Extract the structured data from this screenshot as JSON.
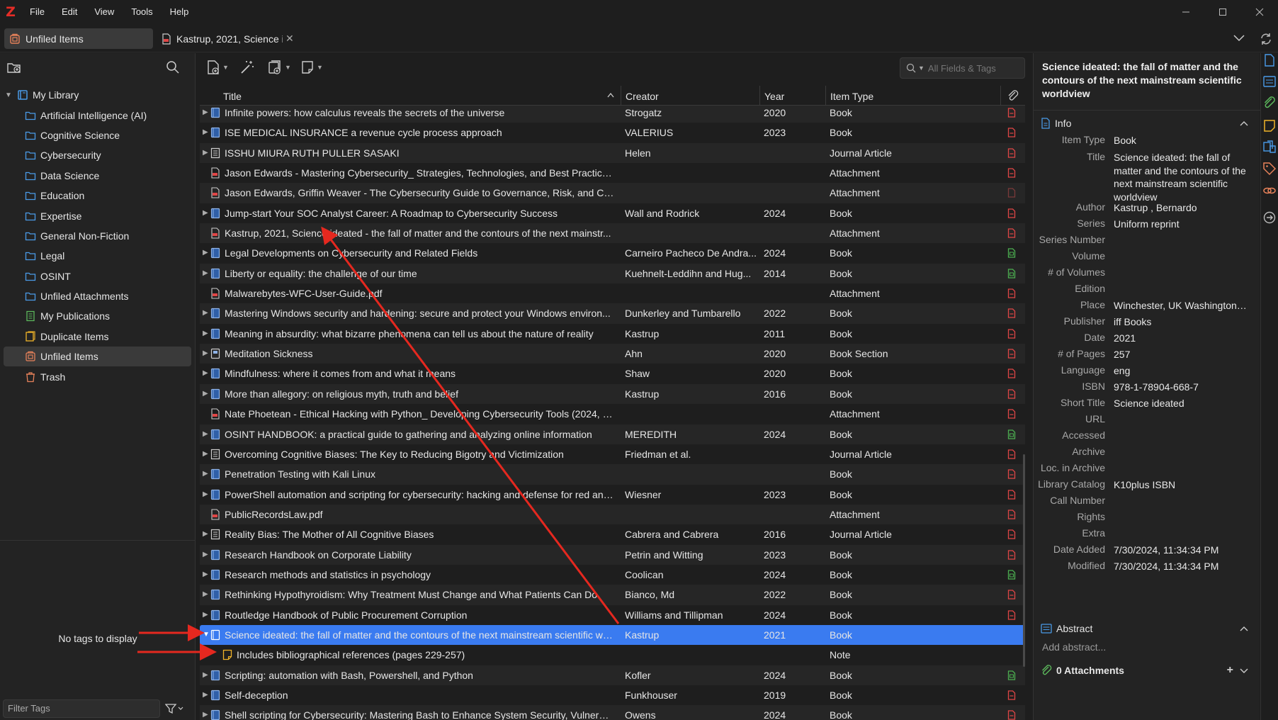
{
  "menubar": {
    "logo": "Z",
    "items": [
      "File",
      "Edit",
      "View",
      "Tools",
      "Help"
    ]
  },
  "tabs": {
    "library_tab": "Unfiled Items",
    "reader_tab": "Kastrup, 2021, Science ide",
    "close_glyph": "✕"
  },
  "collections": {
    "root": "My Library",
    "items": [
      {
        "label": "Artificial Intelligence (AI)",
        "icon": "folder-icon"
      },
      {
        "label": "Cognitive Science",
        "icon": "folder-icon"
      },
      {
        "label": "Cybersecurity",
        "icon": "folder-icon"
      },
      {
        "label": "Data Science",
        "icon": "folder-icon"
      },
      {
        "label": "Education",
        "icon": "folder-icon"
      },
      {
        "label": "Expertise",
        "icon": "folder-icon"
      },
      {
        "label": "General Non-Fiction",
        "icon": "folder-icon"
      },
      {
        "label": "Legal",
        "icon": "folder-icon"
      },
      {
        "label": "OSINT",
        "icon": "folder-icon"
      },
      {
        "label": "Unfiled Attachments",
        "icon": "folder-icon"
      },
      {
        "label": "My Publications",
        "icon": "publications-icon"
      },
      {
        "label": "Duplicate Items",
        "icon": "duplicate-icon"
      },
      {
        "label": "Unfiled Items",
        "icon": "unfiled-icon"
      },
      {
        "label": "Trash",
        "icon": "trash-icon"
      }
    ]
  },
  "tags": {
    "empty_message": "No tags to display",
    "filter_placeholder": "Filter Tags"
  },
  "search": {
    "placeholder": "All Fields & Tags"
  },
  "table": {
    "headers": {
      "title": "Title",
      "creator": "Creator",
      "year": "Year",
      "type": "Item Type"
    },
    "rows": [
      {
        "title": "Infinite powers: how calculus reveals the secrets of the universe",
        "creator": "Strogatz",
        "year": "2020",
        "type": "Book",
        "icon": "book",
        "att": "pdf",
        "expand": true
      },
      {
        "title": "ISE MEDICAL INSURANCE a revenue cycle process approach",
        "creator": "VALERIUS",
        "year": "2023",
        "type": "Book",
        "icon": "book",
        "att": "pdf",
        "expand": true
      },
      {
        "title": "ISSHU MIURA RUTH PULLER SASAKI",
        "creator": "Helen",
        "year": "",
        "type": "Journal Article",
        "icon": "article",
        "att": "pdf",
        "expand": true
      },
      {
        "title": "Jason Edwards - Mastering Cybersecurity_ Strategies, Technologies, and Best Practices-...",
        "creator": "",
        "year": "",
        "type": "Attachment",
        "icon": "pdf",
        "att": "pdf",
        "expand": false
      },
      {
        "title": "Jason Edwards, Griffin Weaver - The Cybersecurity Guide to Governance, Risk, and Com...",
        "creator": "",
        "year": "",
        "type": "Attachment",
        "icon": "pdf",
        "att": "pdf-dim",
        "expand": false
      },
      {
        "title": "Jump-start Your SOC Analyst Career: A Roadmap to Cybersecurity Success",
        "creator": "Wall and Rodrick",
        "year": "2024",
        "type": "Book",
        "icon": "book",
        "att": "pdf",
        "expand": true
      },
      {
        "title": "Kastrup, 2021, Science ideated - the fall of matter and the contours of the next mainstr...",
        "creator": "",
        "year": "",
        "type": "Attachment",
        "icon": "pdf",
        "att": "pdf",
        "expand": false
      },
      {
        "title": "Legal Developments on Cybersecurity and Related Fields",
        "creator": "Carneiro Pacheco De Andra...",
        "year": "2024",
        "type": "Book",
        "icon": "book",
        "att": "epub",
        "expand": true
      },
      {
        "title": "Liberty or equality: the challenge of our time",
        "creator": "Kuehnelt-Leddihn and Hug...",
        "year": "2014",
        "type": "Book",
        "icon": "book",
        "att": "epub",
        "expand": true
      },
      {
        "title": "Malwarebytes-WFC-User-Guide.pdf",
        "creator": "",
        "year": "",
        "type": "Attachment",
        "icon": "pdf",
        "att": "pdf",
        "expand": false
      },
      {
        "title": "Mastering Windows security and hardening: secure and protect your Windows environ...",
        "creator": "Dunkerley and Tumbarello",
        "year": "2022",
        "type": "Book",
        "icon": "book",
        "att": "pdf",
        "expand": true
      },
      {
        "title": "Meaning in absurdity: what bizarre phenomena can tell us about the nature of reality",
        "creator": "Kastrup",
        "year": "2011",
        "type": "Book",
        "icon": "book",
        "att": "pdf",
        "expand": true
      },
      {
        "title": "Meditation Sickness",
        "creator": "Ahn",
        "year": "2020",
        "type": "Book Section",
        "icon": "section",
        "att": "pdf",
        "expand": true
      },
      {
        "title": "Mindfulness: where it comes from and what it means",
        "creator": "Shaw",
        "year": "2020",
        "type": "Book",
        "icon": "book",
        "att": "pdf",
        "expand": true
      },
      {
        "title": "More than allegory: on religious myth, truth and belief",
        "creator": "Kastrup",
        "year": "2016",
        "type": "Book",
        "icon": "book",
        "att": "pdf",
        "expand": true
      },
      {
        "title": "Nate Phoetean - Ethical Hacking with Python_ Developing Cybersecurity Tools (2024, In...",
        "creator": "",
        "year": "",
        "type": "Attachment",
        "icon": "pdf",
        "att": "pdf",
        "expand": false
      },
      {
        "title": "OSINT HANDBOOK: a practical guide to gathering and analyzing online information",
        "creator": "MEREDITH",
        "year": "2024",
        "type": "Book",
        "icon": "book",
        "att": "epub",
        "expand": true
      },
      {
        "title": "Overcoming Cognitive Biases: The Key to Reducing Bigotry and Victimization",
        "creator": "Friedman et al.",
        "year": "",
        "type": "Journal Article",
        "icon": "article",
        "att": "pdf",
        "expand": true
      },
      {
        "title": "Penetration Testing with Kali Linux",
        "creator": "",
        "year": "",
        "type": "Book",
        "icon": "book",
        "att": "pdf",
        "expand": true
      },
      {
        "title": "PowerShell automation and scripting for cybersecurity: hacking and defense for red and ...",
        "creator": "Wiesner",
        "year": "2023",
        "type": "Book",
        "icon": "book",
        "att": "pdf",
        "expand": true
      },
      {
        "title": "PublicRecordsLaw.pdf",
        "creator": "",
        "year": "",
        "type": "Attachment",
        "icon": "pdf",
        "att": "pdf",
        "expand": false
      },
      {
        "title": "Reality Bias: The Mother of All Cognitive Biases",
        "creator": "Cabrera and Cabrera",
        "year": "2016",
        "type": "Journal Article",
        "icon": "article",
        "att": "pdf",
        "expand": true
      },
      {
        "title": "Research Handbook on Corporate Liability",
        "creator": "Petrin and Witting",
        "year": "2023",
        "type": "Book",
        "icon": "book",
        "att": "pdf",
        "expand": true
      },
      {
        "title": "Research methods and statistics in psychology",
        "creator": "Coolican",
        "year": "2024",
        "type": "Book",
        "icon": "book",
        "att": "epub",
        "expand": true
      },
      {
        "title": "Rethinking Hypothyroidism: Why Treatment Must Change and What Patients Can Do",
        "creator": "Bianco, Md",
        "year": "2022",
        "type": "Book",
        "icon": "book",
        "att": "pdf",
        "expand": true
      },
      {
        "title": "Routledge Handbook of Public Procurement Corruption",
        "creator": "Williams and Tillipman",
        "year": "2024",
        "type": "Book",
        "icon": "book",
        "att": "pdf",
        "expand": true
      },
      {
        "title": "Science ideated: the fall of matter and the contours of the next mainstream scientific wo...",
        "creator": "Kastrup",
        "year": "2021",
        "type": "Book",
        "icon": "book",
        "att": "",
        "expand": "open",
        "selected": true
      },
      {
        "title": "Includes bibliographical references (pages 229-257)",
        "creator": "",
        "year": "",
        "type": "Note",
        "icon": "note",
        "att": "",
        "expand": false,
        "note": true
      },
      {
        "title": "Scripting: automation with Bash, Powershell, and Python",
        "creator": "Kofler",
        "year": "2024",
        "type": "Book",
        "icon": "book",
        "att": "epub",
        "expand": true
      },
      {
        "title": "Self-deception",
        "creator": "Funkhouser",
        "year": "2019",
        "type": "Book",
        "icon": "book",
        "att": "pdf",
        "expand": true
      },
      {
        "title": "Shell scripting for Cybersecurity: Mastering Bash to Enhance System Security, Vulnerabili...",
        "creator": "Owens",
        "year": "2024",
        "type": "Book",
        "icon": "book",
        "att": "pdf",
        "expand": true
      }
    ]
  },
  "item_pane": {
    "title": "Science ideated: the fall of matter and the contours of the next mainstream scientific worldview",
    "info_heading": "Info",
    "fields": [
      {
        "label": "Item Type",
        "value": "Book"
      },
      {
        "label": "Title",
        "value": "Science ideated: the fall of matter and the contours of the next mainstream scientific worldview"
      },
      {
        "label": "Author",
        "value": "Kastrup , Bernardo"
      },
      {
        "label": "Series",
        "value": "Uniform reprint"
      },
      {
        "label": "Series Number",
        "value": ""
      },
      {
        "label": "Volume",
        "value": ""
      },
      {
        "label": "# of Volumes",
        "value": ""
      },
      {
        "label": "Edition",
        "value": ""
      },
      {
        "label": "Place",
        "value": "Winchester, UK Washington, ..."
      },
      {
        "label": "Publisher",
        "value": "iff Books"
      },
      {
        "label": "Date",
        "value": "2021"
      },
      {
        "label": "# of Pages",
        "value": "257"
      },
      {
        "label": "Language",
        "value": "eng"
      },
      {
        "label": "ISBN",
        "value": "978-1-78904-668-7"
      },
      {
        "label": "Short Title",
        "value": "Science ideated"
      },
      {
        "label": "URL",
        "value": ""
      },
      {
        "label": "Accessed",
        "value": ""
      },
      {
        "label": "Archive",
        "value": ""
      },
      {
        "label": "Loc. in Archive",
        "value": ""
      },
      {
        "label": "Library Catalog",
        "value": "K10plus ISBN"
      },
      {
        "label": "Call Number",
        "value": ""
      },
      {
        "label": "Rights",
        "value": ""
      },
      {
        "label": "Extra",
        "value": ""
      },
      {
        "label": "Date Added",
        "value": "7/30/2024, 11:34:34 PM"
      },
      {
        "label": "Modified",
        "value": "7/30/2024, 11:34:34 PM"
      }
    ],
    "abstract_heading": "Abstract",
    "abstract_placeholder": "Add abstract...",
    "attachments_heading": "0 Attachments"
  },
  "colors": {
    "accent": "#3a7bf0",
    "annotation_red": "#e5281f",
    "pdf_red": "#e04646",
    "epub_green": "#4caf50",
    "folder_blue": "#4a9be8"
  }
}
